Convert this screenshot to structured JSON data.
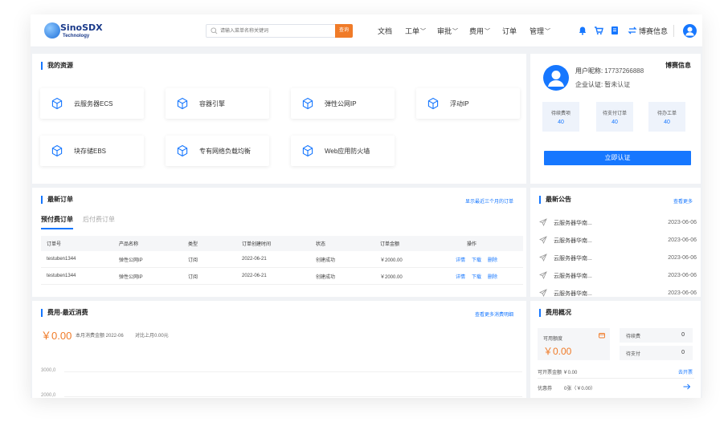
{
  "brand": {
    "name": "SinoSDX",
    "tagline": "Technology"
  },
  "search": {
    "placeholder": "请输入菜单名称关键词",
    "button_label": "查询"
  },
  "nav": {
    "docs": "文档",
    "tickets": "工单",
    "approval": "审批",
    "billing": "费用",
    "orders": "订单",
    "manage": "管理"
  },
  "user": {
    "display_name": "博赛信息"
  },
  "resources": {
    "title": "我的资源",
    "items": [
      {
        "label": "云服务器ECS"
      },
      {
        "label": "容器引擎"
      },
      {
        "label": "弹性公网IP"
      },
      {
        "label": "浮动IP"
      },
      {
        "label": "块存储EBS"
      },
      {
        "label": "专有网络负载均衡"
      },
      {
        "label": "Web应用防火墙"
      }
    ]
  },
  "profile": {
    "company": "博赛信息",
    "nickname_label": "用户昵称:",
    "nickname": "17737266888",
    "cert_label": "企业认证:",
    "cert_status": "暂未认证",
    "stats": [
      {
        "label": "待续费项",
        "value": "40"
      },
      {
        "label": "待支付订单",
        "value": "40"
      },
      {
        "label": "待办工单",
        "value": "40"
      }
    ],
    "cert_button": "立即认证"
  },
  "orders": {
    "title": "最新订单",
    "link": "显示最近三个月的订单",
    "tabs": {
      "prepaid": "预付费订单",
      "postpaid": "后付费订单"
    },
    "headers": {
      "order_no": "订单号",
      "product": "产品名称",
      "type": "类型",
      "created": "订单创建时间",
      "status": "状态",
      "amount": "订单金额",
      "ops": "操作"
    },
    "rows": [
      {
        "order_no": "testuben1344",
        "product": "弹性公网IP",
        "type": "订阅",
        "created": "2022-06-21",
        "status": "创建成功",
        "amount": "￥2000.00",
        "detail": "详情",
        "download": "下载",
        "delete": "删除"
      },
      {
        "order_no": "testuben1344",
        "product": "弹性公网IP",
        "type": "订阅",
        "created": "2022-06-21",
        "status": "创建成功",
        "amount": "￥2000.00",
        "detail": "详情",
        "download": "下载",
        "delete": "删除"
      }
    ]
  },
  "notices": {
    "title": "最新公告",
    "link": "查看更多",
    "items": [
      {
        "title": "云服务器华南...",
        "date": "2023-06-06"
      },
      {
        "title": "云服务器华南...",
        "date": "2023-06-06"
      },
      {
        "title": "云服务器华南...",
        "date": "2023-06-06"
      },
      {
        "title": "云服务器华南...",
        "date": "2023-06-06"
      },
      {
        "title": "云服务器华南...",
        "date": "2023-06-06"
      }
    ]
  },
  "spending": {
    "title": "费用-最近消费",
    "link": "查看更多消费明细",
    "amount": "￥0.00",
    "month_note": "本月消费金额 2022-06",
    "compare_note": "对比上月0.00元",
    "y_ticks": [
      "3000,0",
      "2000,0"
    ]
  },
  "fees": {
    "title": "费用概况",
    "available_label": "可用额度",
    "available_value": "￥0.00",
    "renew_label": "待续费",
    "renew_value": "0",
    "unpaid_label": "待支付",
    "unpaid_value": "0",
    "invoice_label": "可开票金额 ￥0.00",
    "invoice_link": "去开票",
    "coupon_label": "优惠券",
    "coupon_value": "0张（￥0.00）"
  },
  "colors": {
    "accent": "#1677ff",
    "orange": "#f07b28",
    "background": "#f0f2f5"
  }
}
